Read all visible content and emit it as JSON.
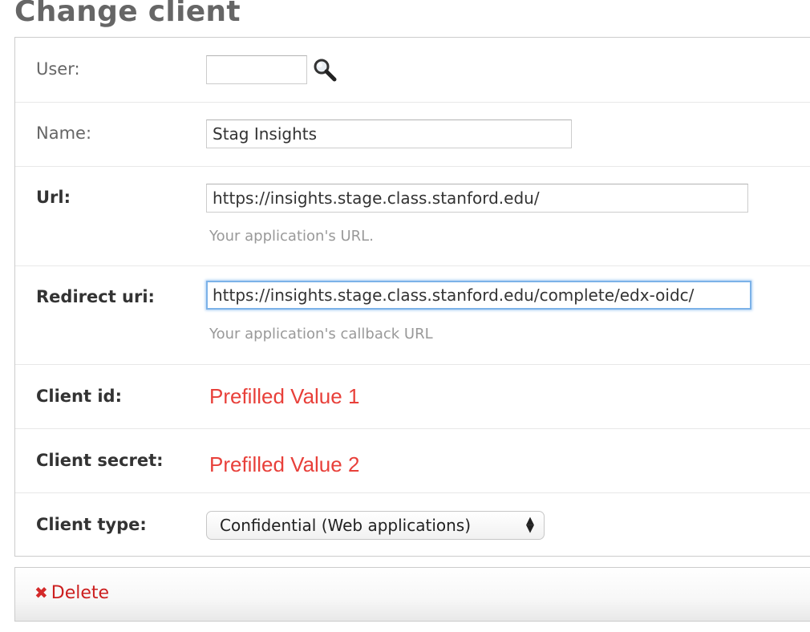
{
  "page": {
    "title": "Change client"
  },
  "fields": {
    "user": {
      "label": "User:",
      "value": ""
    },
    "name": {
      "label": "Name:",
      "value": "Stag Insights"
    },
    "url": {
      "label": "Url:",
      "value": "https://insights.stage.class.stanford.edu/",
      "help": "Your application's URL."
    },
    "redirect_uri": {
      "label": "Redirect uri:",
      "value": "https://insights.stage.class.stanford.edu/complete/edx-oidc/",
      "help": "Your application's callback URL"
    },
    "client_id": {
      "label": "Client id:",
      "value": "Prefilled Value 1"
    },
    "client_secret": {
      "label": "Client secret:",
      "value": "Prefilled Value 2"
    },
    "client_type": {
      "label": "Client type:",
      "value": "Confidential (Web applications)"
    }
  },
  "actions": {
    "delete_label": "Delete"
  },
  "icons": {
    "lookup": "magnifier-icon",
    "delete": "red-x-icon",
    "select_arrows": "up-down-arrows-icon"
  },
  "colors": {
    "title": "#666666",
    "prefilled_value": "#e8403a",
    "delete_link": "#cc1f1f",
    "focus_ring": "#7cb2e8"
  }
}
